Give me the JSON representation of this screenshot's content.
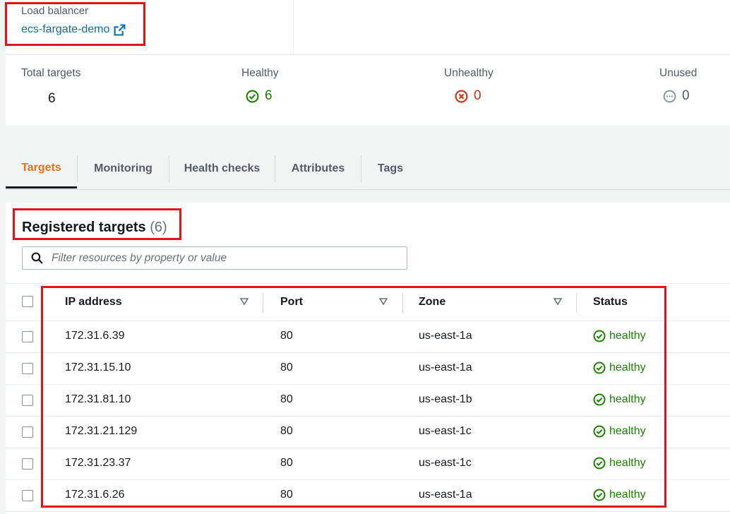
{
  "load_balancer": {
    "label": "Load balancer",
    "link_text": "ecs-fargate-demo",
    "link_icon": "external-link-icon"
  },
  "stats": {
    "total": {
      "label": "Total targets",
      "value": "6"
    },
    "healthy": {
      "label": "Healthy",
      "value": "6",
      "color": "#1d8102"
    },
    "unhealthy": {
      "label": "Unhealthy",
      "value": "0",
      "color": "#d13212"
    },
    "unused": {
      "label": "Unused",
      "value": "0",
      "color": "#687078"
    }
  },
  "tabs": [
    {
      "label": "Targets",
      "active": true
    },
    {
      "label": "Monitoring"
    },
    {
      "label": "Health checks"
    },
    {
      "label": "Attributes"
    },
    {
      "label": "Tags"
    }
  ],
  "panel": {
    "title": "Registered targets",
    "count": "(6)",
    "filter_placeholder": "Filter resources by property or value"
  },
  "table": {
    "columns": [
      "IP address",
      "Port",
      "Zone",
      "Status"
    ],
    "rows": [
      {
        "ip": "172.31.6.39",
        "port": "80",
        "zone": "us-east-1a",
        "status": "healthy"
      },
      {
        "ip": "172.31.15.10",
        "port": "80",
        "zone": "us-east-1a",
        "status": "healthy"
      },
      {
        "ip": "172.31.81.10",
        "port": "80",
        "zone": "us-east-1b",
        "status": "healthy"
      },
      {
        "ip": "172.31.21.129",
        "port": "80",
        "zone": "us-east-1c",
        "status": "healthy"
      },
      {
        "ip": "172.31.23.37",
        "port": "80",
        "zone": "us-east-1c",
        "status": "healthy"
      },
      {
        "ip": "172.31.6.26",
        "port": "80",
        "zone": "us-east-1a",
        "status": "healthy"
      }
    ]
  },
  "colors": {
    "highlight": "#e0141e",
    "active_tab": "#ec7211",
    "link": "#0073bb",
    "healthy": "#1d8102"
  }
}
